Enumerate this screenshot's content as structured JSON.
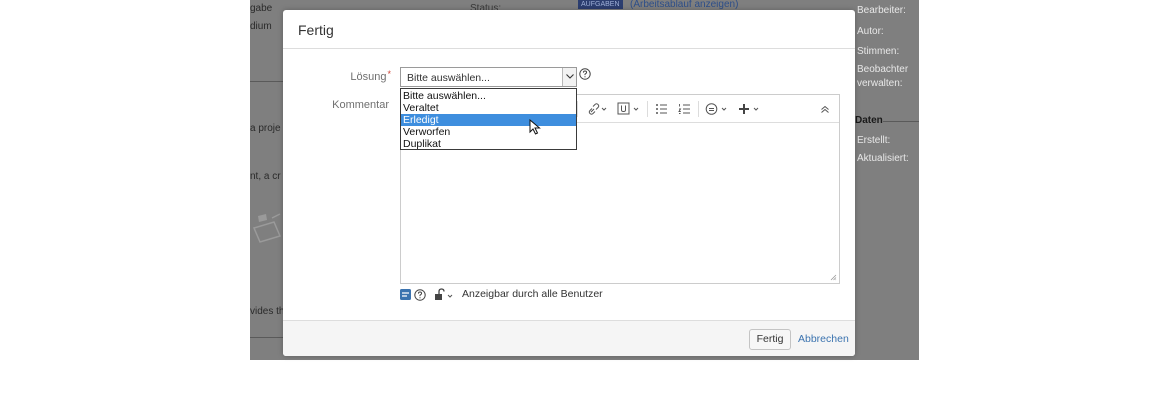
{
  "background": {
    "left_fragments": [
      "gabe",
      "dium",
      "a proje",
      "nt, a cr",
      "vides th"
    ],
    "status_label": "Status:",
    "status_badge": "AUFGABEN",
    "status_link": "(Arbeitsablauf anzeigen)",
    "right_fields": [
      "Bearbeiter:",
      "Autor:",
      "Stimmen:",
      "Beobachter",
      "verwalten:"
    ],
    "dates_header": "Daten",
    "date_fields": [
      "Erstellt:",
      "Aktualisiert:"
    ]
  },
  "dialog": {
    "title": "Fertig",
    "resolution": {
      "label": "Lösung",
      "required_marker": "*",
      "selected": "Bitte auswählen...",
      "options": [
        "Bitte auswählen...",
        "Veraltet",
        "Erledigt",
        "Verworfen",
        "Duplikat"
      ],
      "highlighted_option": "Erledigt"
    },
    "comment": {
      "label": "Kommentar",
      "value": ""
    },
    "visibility": "Anzeigbar durch alle Benutzer",
    "submit_label": "Fertig",
    "cancel_label": "Abbrechen"
  },
  "colors": {
    "overlay": "#7f7f7f",
    "accent_blue": "#3b73af",
    "selection": "#3e8ede",
    "required": "#d04437"
  },
  "icons": [
    "chevron-down-icon",
    "help-icon",
    "link-icon",
    "attachment-icon",
    "bullet-list-icon",
    "numbered-list-icon",
    "emoticon-icon",
    "plus-icon",
    "collapse-icon",
    "mouse-cursor-icon",
    "visibility-icon",
    "lock-icon"
  ]
}
